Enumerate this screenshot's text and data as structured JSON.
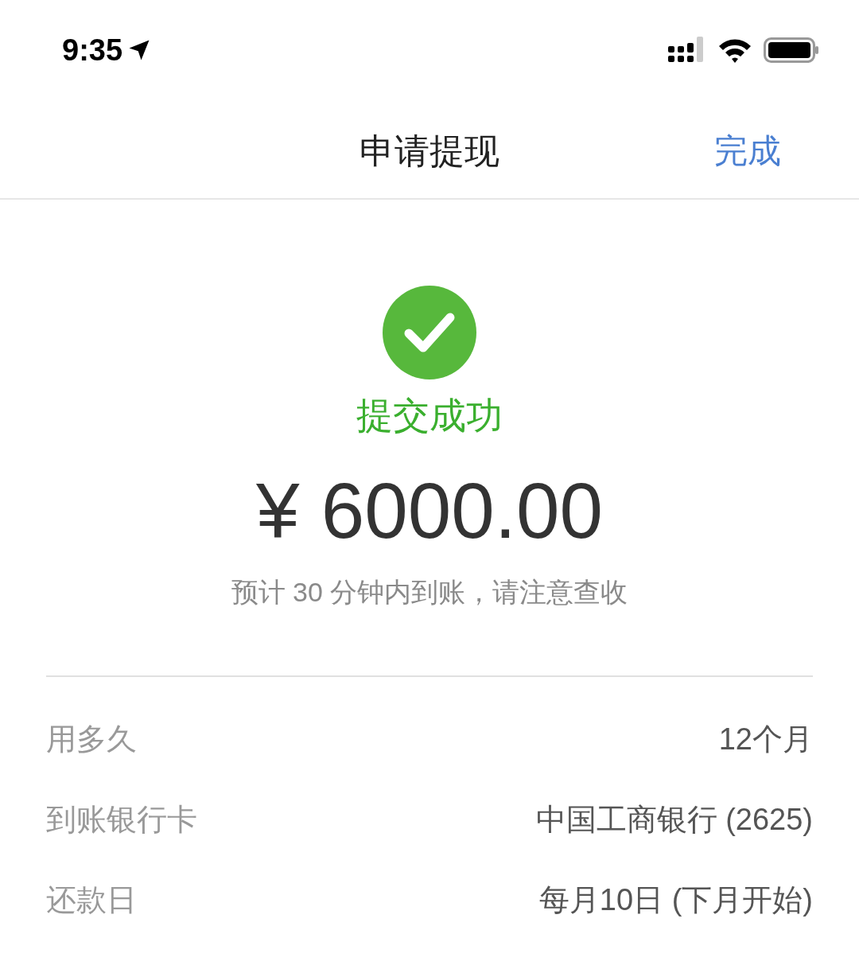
{
  "status_bar": {
    "time": "9:35"
  },
  "nav": {
    "title": "申请提现",
    "action": "完成"
  },
  "result": {
    "status": "提交成功",
    "amount": "¥ 6000.00",
    "note": "预计 30 分钟内到账，请注意查收"
  },
  "details": [
    {
      "label": "用多久",
      "value": "12个月"
    },
    {
      "label": "到账银行卡",
      "value": "中国工商银行 (2625)"
    },
    {
      "label": "还款日",
      "value": "每月10日 (下月开始)"
    }
  ]
}
